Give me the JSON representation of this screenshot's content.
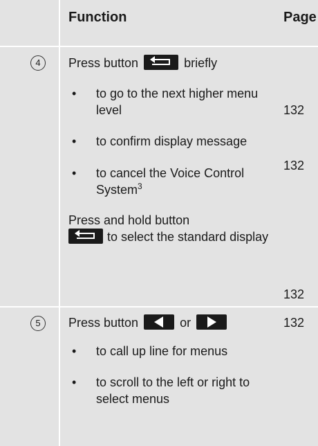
{
  "header": {
    "function": "Function",
    "page": "Page"
  },
  "row4": {
    "step": "4",
    "press_prefix": "Press button",
    "press_suffix": "briefly",
    "bullets": [
      {
        "text": "to go to the next higher menu level",
        "page": "132"
      },
      {
        "text": "to confirm display message",
        "page": "132"
      },
      {
        "text": "to cancel the Voice Control System",
        "sup": "3"
      }
    ],
    "hold_prefix": "Press and hold button",
    "hold_suffix": "to select the standard display",
    "hold_page": "132"
  },
  "row5": {
    "step": "5",
    "press_prefix": "Press button",
    "or_word": "or",
    "page": "132",
    "bullets": [
      {
        "text": "to call up line for menus"
      },
      {
        "text": "to scroll to the left or right to select menus"
      }
    ]
  },
  "icons": {
    "back": "back-arrow-icon",
    "left": "left-arrow-icon",
    "right": "right-arrow-icon"
  },
  "colors": {
    "background": "#e3e3e3",
    "separator": "#ffffff",
    "text": "#1a1a1a"
  }
}
